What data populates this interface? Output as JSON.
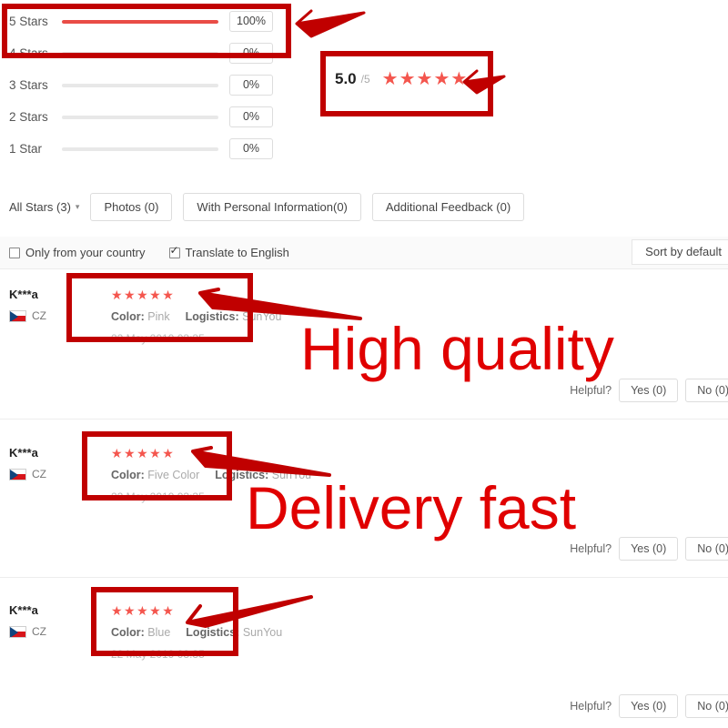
{
  "rating_summary": {
    "score": "5.0",
    "score_max": "/5",
    "stars_glyph": "★★★★★",
    "accent_color": "#e94c46",
    "rows": [
      {
        "label": "5 Stars",
        "percent_label": "100%",
        "percent": 100
      },
      {
        "label": "4 Stars",
        "percent_label": "0%",
        "percent": 0
      },
      {
        "label": "3 Stars",
        "percent_label": "0%",
        "percent": 0
      },
      {
        "label": "2 Stars",
        "percent_label": "0%",
        "percent": 0
      },
      {
        "label": "1 Star",
        "percent_label": "0%",
        "percent": 0
      }
    ]
  },
  "filters": {
    "all_stars_label": "All Stars (3)",
    "caret_icon": "chevron-down-icon",
    "chips": [
      "Photos (0)",
      "With Personal Information(0)",
      "Additional Feedback (0)"
    ]
  },
  "options": {
    "only_country_label": "Only from your country",
    "only_country_checked": false,
    "translate_label": "Translate to English",
    "translate_checked": true,
    "sort_label": "Sort by default"
  },
  "reviews": [
    {
      "user": "K***a",
      "country_code": "CZ",
      "stars": "★★★★★",
      "attr1_key": "Color:",
      "attr1_val": "Pink",
      "attr2_key": "Logistics:",
      "attr2_val": "SunYou",
      "date": "22 May 2019 03:35",
      "helpful_label": "Helpful?",
      "yes_label": "Yes (0)",
      "no_label": "No (0)"
    },
    {
      "user": "K***a",
      "country_code": "CZ",
      "stars": "★★★★★",
      "attr1_key": "Color:",
      "attr1_val": "Five Color",
      "attr2_key": "Logistics:",
      "attr2_val": "SunYou",
      "date": "22 May 2019 03:35",
      "helpful_label": "Helpful?",
      "yes_label": "Yes (0)",
      "no_label": "No (0)"
    },
    {
      "user": "K***a",
      "country_code": "CZ",
      "stars": "★★★★★",
      "attr1_key": "Color:",
      "attr1_val": "Blue",
      "attr2_key": "Logistics:",
      "attr2_val": "SunYou",
      "date": "22 May 2019 03:35",
      "helpful_label": "Helpful?",
      "yes_label": "Yes (0)",
      "no_label": "No (0)"
    }
  ],
  "annotations": {
    "color": "#c00000",
    "text_color": "#e00000",
    "callout_1": "High quality",
    "callout_2": "Delivery fast"
  }
}
